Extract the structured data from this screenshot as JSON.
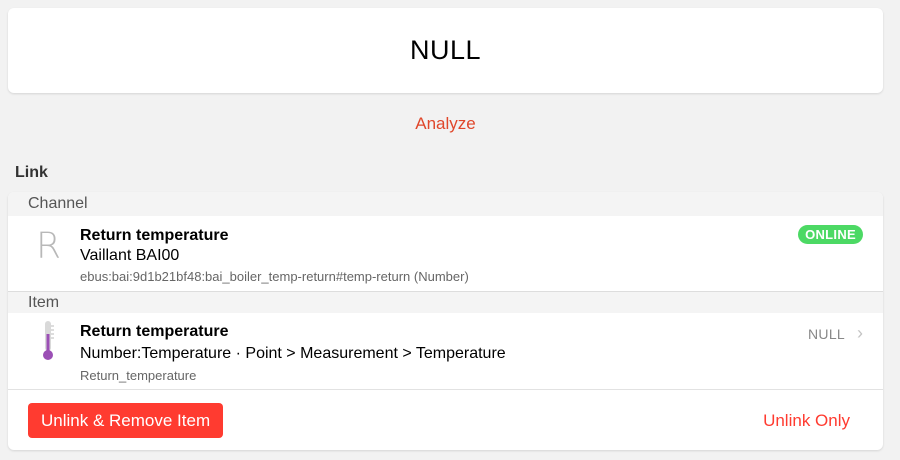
{
  "state": {
    "value": "NULL"
  },
  "analyze_label": "Analyze",
  "section_title": "Link",
  "channel": {
    "header": "Channel",
    "letter": "R",
    "title": "Return temperature",
    "thing": "Vaillant BAI00",
    "uid": "ebus:bai:9d1b21bf48:bai_boiler_temp-return#temp-return (Number)",
    "status": "ONLINE"
  },
  "item": {
    "header": "Item",
    "icon": "thermometer-icon",
    "title": "Return temperature",
    "type_info": "Number:Temperature · Point > Measurement > Temperature",
    "name": "Return_temperature",
    "state": "NULL"
  },
  "actions": {
    "unlink_remove": "Unlink & Remove Item",
    "unlink_only": "Unlink Only"
  },
  "colors": {
    "accent": "#e0472b",
    "danger": "#ff3b30",
    "online": "#4cd964"
  }
}
